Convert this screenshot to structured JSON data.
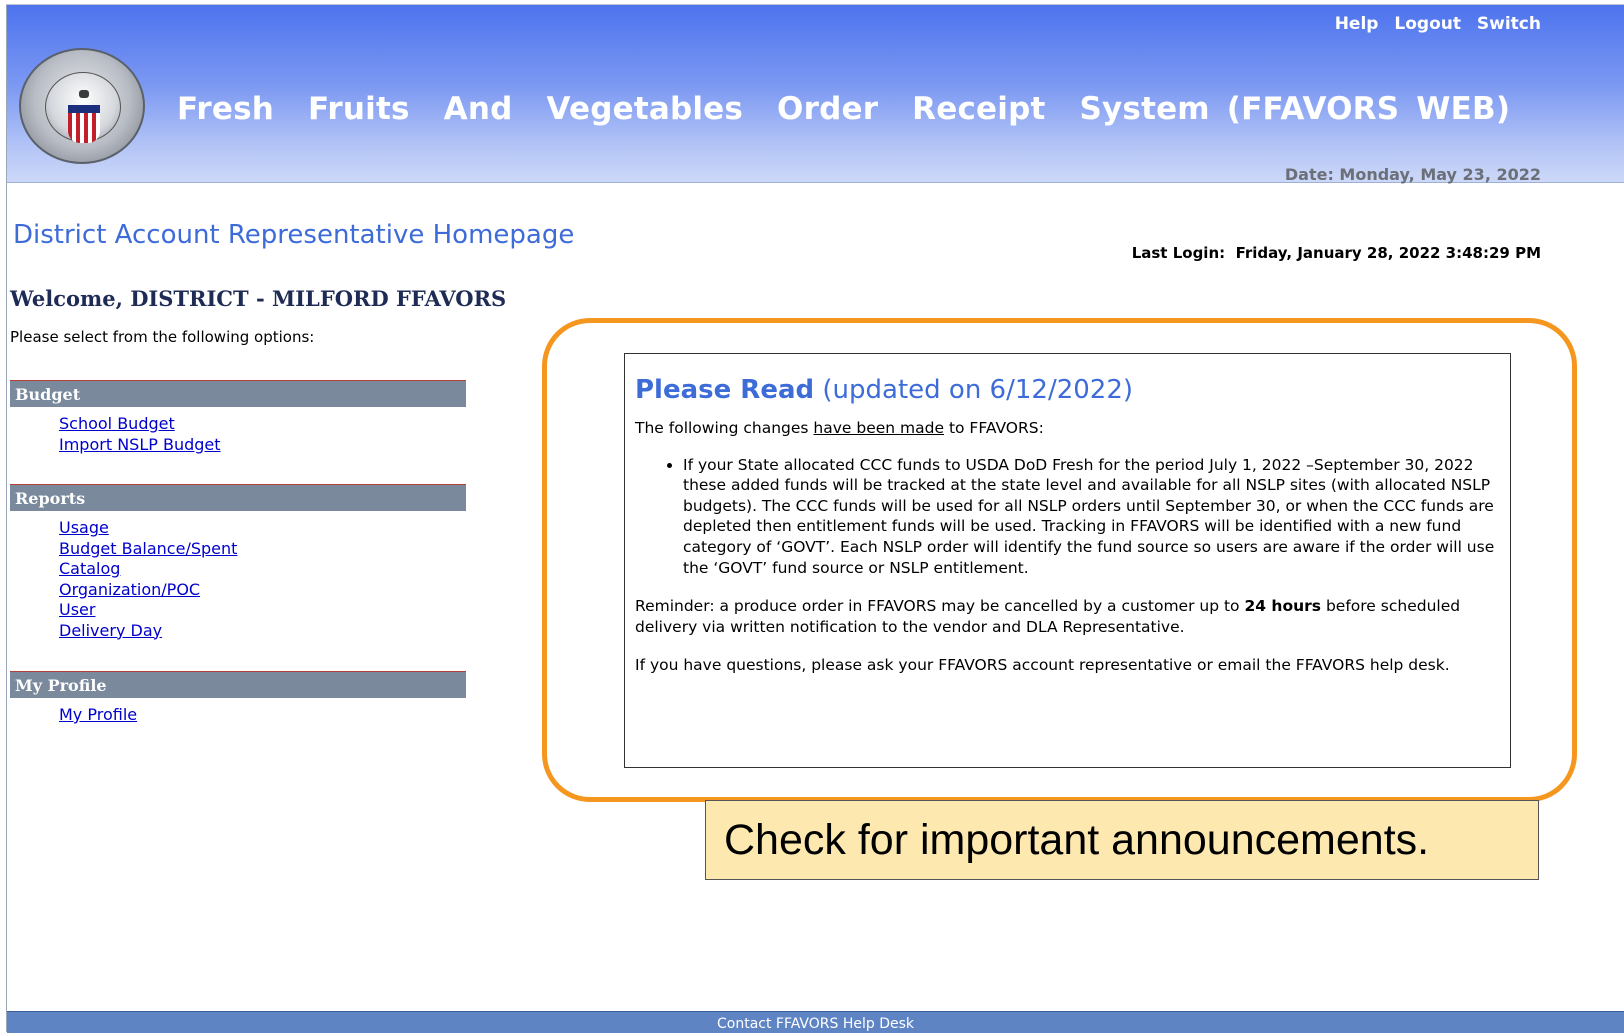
{
  "header": {
    "title": "Fresh  Fruits  And  Vegetables  Order  Receipt  System (FFAVORS WEB)",
    "links": [
      "Help",
      "Logout",
      "Switch"
    ],
    "date": "Date: Monday, May 23, 2022",
    "logo_icon": "dla-seal-icon"
  },
  "page": {
    "title": "District Account Representative Homepage",
    "last_login": "Last Login:  Friday, January 28, 2022 3:48:29 PM",
    "welcome": "Welcome, DISTRICT - MILFORD FFAVORS",
    "instructions": "Please select from the following options:"
  },
  "menu": {
    "budget": {
      "header": "Budget",
      "items": [
        "School Budget",
        "Import NSLP Budget"
      ]
    },
    "reports": {
      "header": "Reports",
      "items": [
        "Usage",
        "Budget Balance/Spent",
        "Catalog",
        "Organization/POC",
        "User",
        "Delivery Day"
      ]
    },
    "profile": {
      "header": "My Profile",
      "items": [
        "My Profile"
      ]
    }
  },
  "notice": {
    "title_bold": "Please Read",
    "title_rest": " (updated on 6/12/2022)",
    "intro_before": "The following changes ",
    "intro_underlined": "have been made",
    "intro_after": " to FFAVORS:",
    "bullet": "If your State allocated CCC funds to USDA DoD Fresh for the period July 1, 2022 –September 30, 2022 these added funds will be tracked at the state level and available for all NSLP sites (with allocated NSLP budgets). The CCC funds will be used for all NSLP orders until September 30, or when the CCC funds are depleted then entitlement funds will be used. Tracking in FFAVORS will be identified with a new fund category of ‘GOVT’. Each NSLP order will identify the fund source so users are aware if the order will use the ‘GOVT’ fund source or NSLP entitlement.",
    "reminder_before": "Reminder: a produce order in FFAVORS may be cancelled by a customer up to ",
    "reminder_bold": "24 hours",
    "reminder_after": " before scheduled delivery via written notification to the vendor and DLA Representative.",
    "questions": "If you have questions, please ask your FFAVORS account representative or email the FFAVORS help desk."
  },
  "callout": "Check for important announcements.",
  "footer": "Contact FFAVORS Help Desk",
  "colors": {
    "header_top": "#4d73ee",
    "highlight_border": "#f5961e",
    "callout_bg": "#fde9b0",
    "menu_header_bg": "#7a8a9c",
    "footer_bg": "#5f84c4",
    "link": "#0000cc"
  }
}
